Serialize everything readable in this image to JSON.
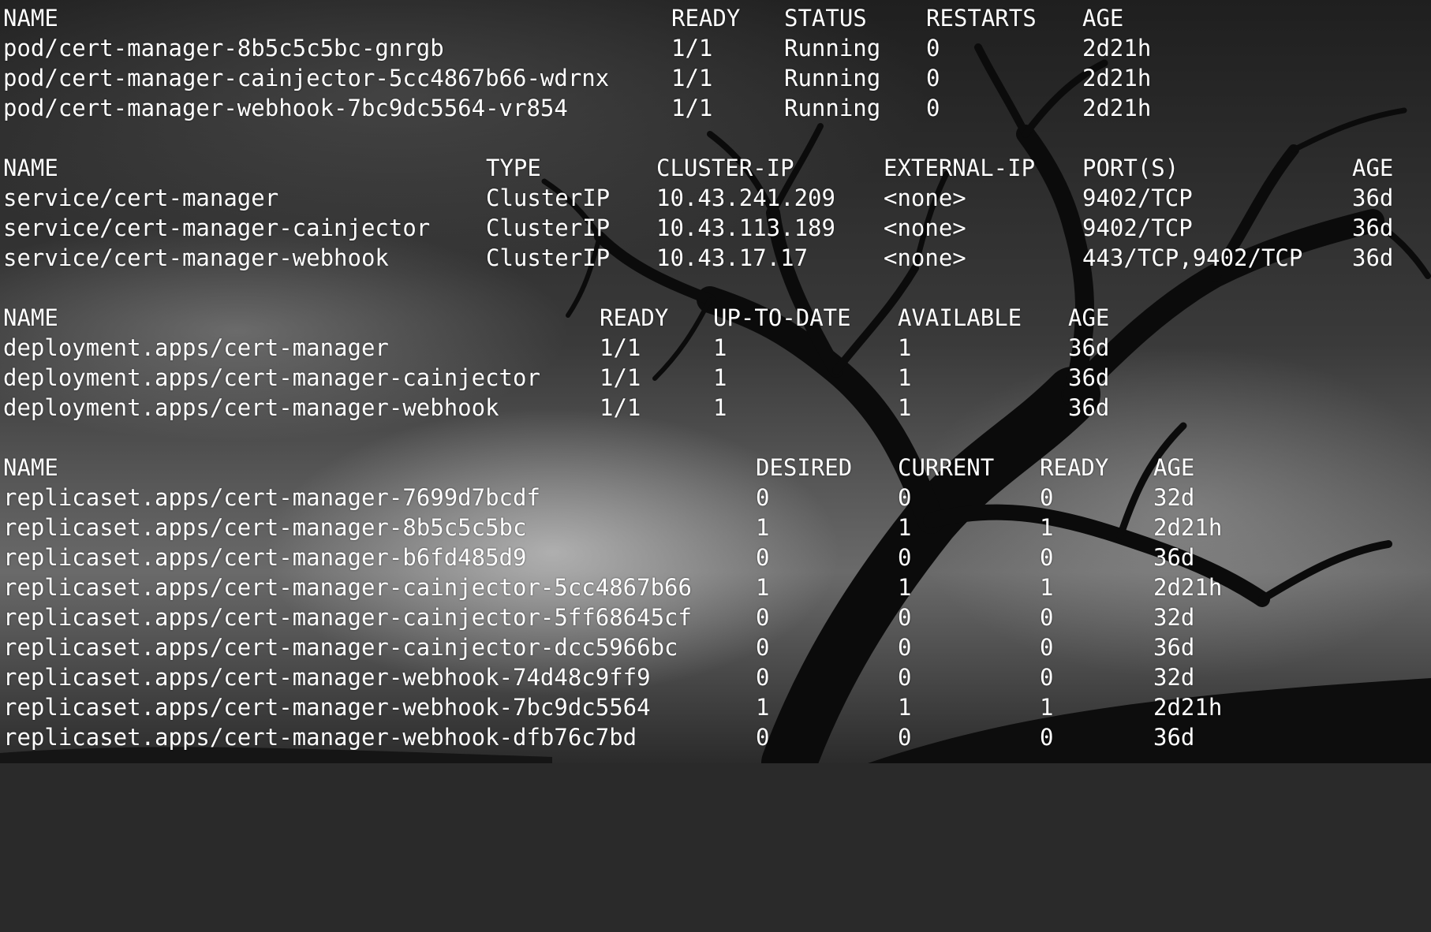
{
  "pods": {
    "headers": [
      "NAME",
      "READY",
      "STATUS",
      "RESTARTS",
      "AGE"
    ],
    "rows": [
      [
        "pod/cert-manager-8b5c5c5bc-gnrgb",
        "1/1",
        "Running",
        "0",
        "2d21h"
      ],
      [
        "pod/cert-manager-cainjector-5cc4867b66-wdrnx",
        "1/1",
        "Running",
        "0",
        "2d21h"
      ],
      [
        "pod/cert-manager-webhook-7bc9dc5564-vr854",
        "1/1",
        "Running",
        "0",
        "2d21h"
      ]
    ]
  },
  "services": {
    "headers": [
      "NAME",
      "TYPE",
      "CLUSTER-IP",
      "EXTERNAL-IP",
      "PORT(S)",
      "AGE"
    ],
    "rows": [
      [
        "service/cert-manager",
        "ClusterIP",
        "10.43.241.209",
        "<none>",
        "9402/TCP",
        "36d"
      ],
      [
        "service/cert-manager-cainjector",
        "ClusterIP",
        "10.43.113.189",
        "<none>",
        "9402/TCP",
        "36d"
      ],
      [
        "service/cert-manager-webhook",
        "ClusterIP",
        "10.43.17.17",
        "<none>",
        "443/TCP,9402/TCP",
        "36d"
      ]
    ]
  },
  "deployments": {
    "headers": [
      "NAME",
      "READY",
      "UP-TO-DATE",
      "AVAILABLE",
      "AGE"
    ],
    "rows": [
      [
        "deployment.apps/cert-manager",
        "1/1",
        "1",
        "1",
        "36d"
      ],
      [
        "deployment.apps/cert-manager-cainjector",
        "1/1",
        "1",
        "1",
        "36d"
      ],
      [
        "deployment.apps/cert-manager-webhook",
        "1/1",
        "1",
        "1",
        "36d"
      ]
    ]
  },
  "replicasets": {
    "headers": [
      "NAME",
      "DESIRED",
      "CURRENT",
      "READY",
      "AGE"
    ],
    "rows": [
      [
        "replicaset.apps/cert-manager-7699d7bcdf",
        "0",
        "0",
        "0",
        "32d"
      ],
      [
        "replicaset.apps/cert-manager-8b5c5c5bc",
        "1",
        "1",
        "1",
        "2d21h"
      ],
      [
        "replicaset.apps/cert-manager-b6fd485d9",
        "0",
        "0",
        "0",
        "36d"
      ],
      [
        "replicaset.apps/cert-manager-cainjector-5cc4867b66",
        "1",
        "1",
        "1",
        "2d21h"
      ],
      [
        "replicaset.apps/cert-manager-cainjector-5ff68645cf",
        "0",
        "0",
        "0",
        "32d"
      ],
      [
        "replicaset.apps/cert-manager-cainjector-dcc5966bc",
        "0",
        "0",
        "0",
        "36d"
      ],
      [
        "replicaset.apps/cert-manager-webhook-74d48c9ff9",
        "0",
        "0",
        "0",
        "32d"
      ],
      [
        "replicaset.apps/cert-manager-webhook-7bc9dc5564",
        "1",
        "1",
        "1",
        "2d21h"
      ],
      [
        "replicaset.apps/cert-manager-webhook-dfb76c7bd",
        "0",
        "0",
        "0",
        "36d"
      ]
    ]
  }
}
